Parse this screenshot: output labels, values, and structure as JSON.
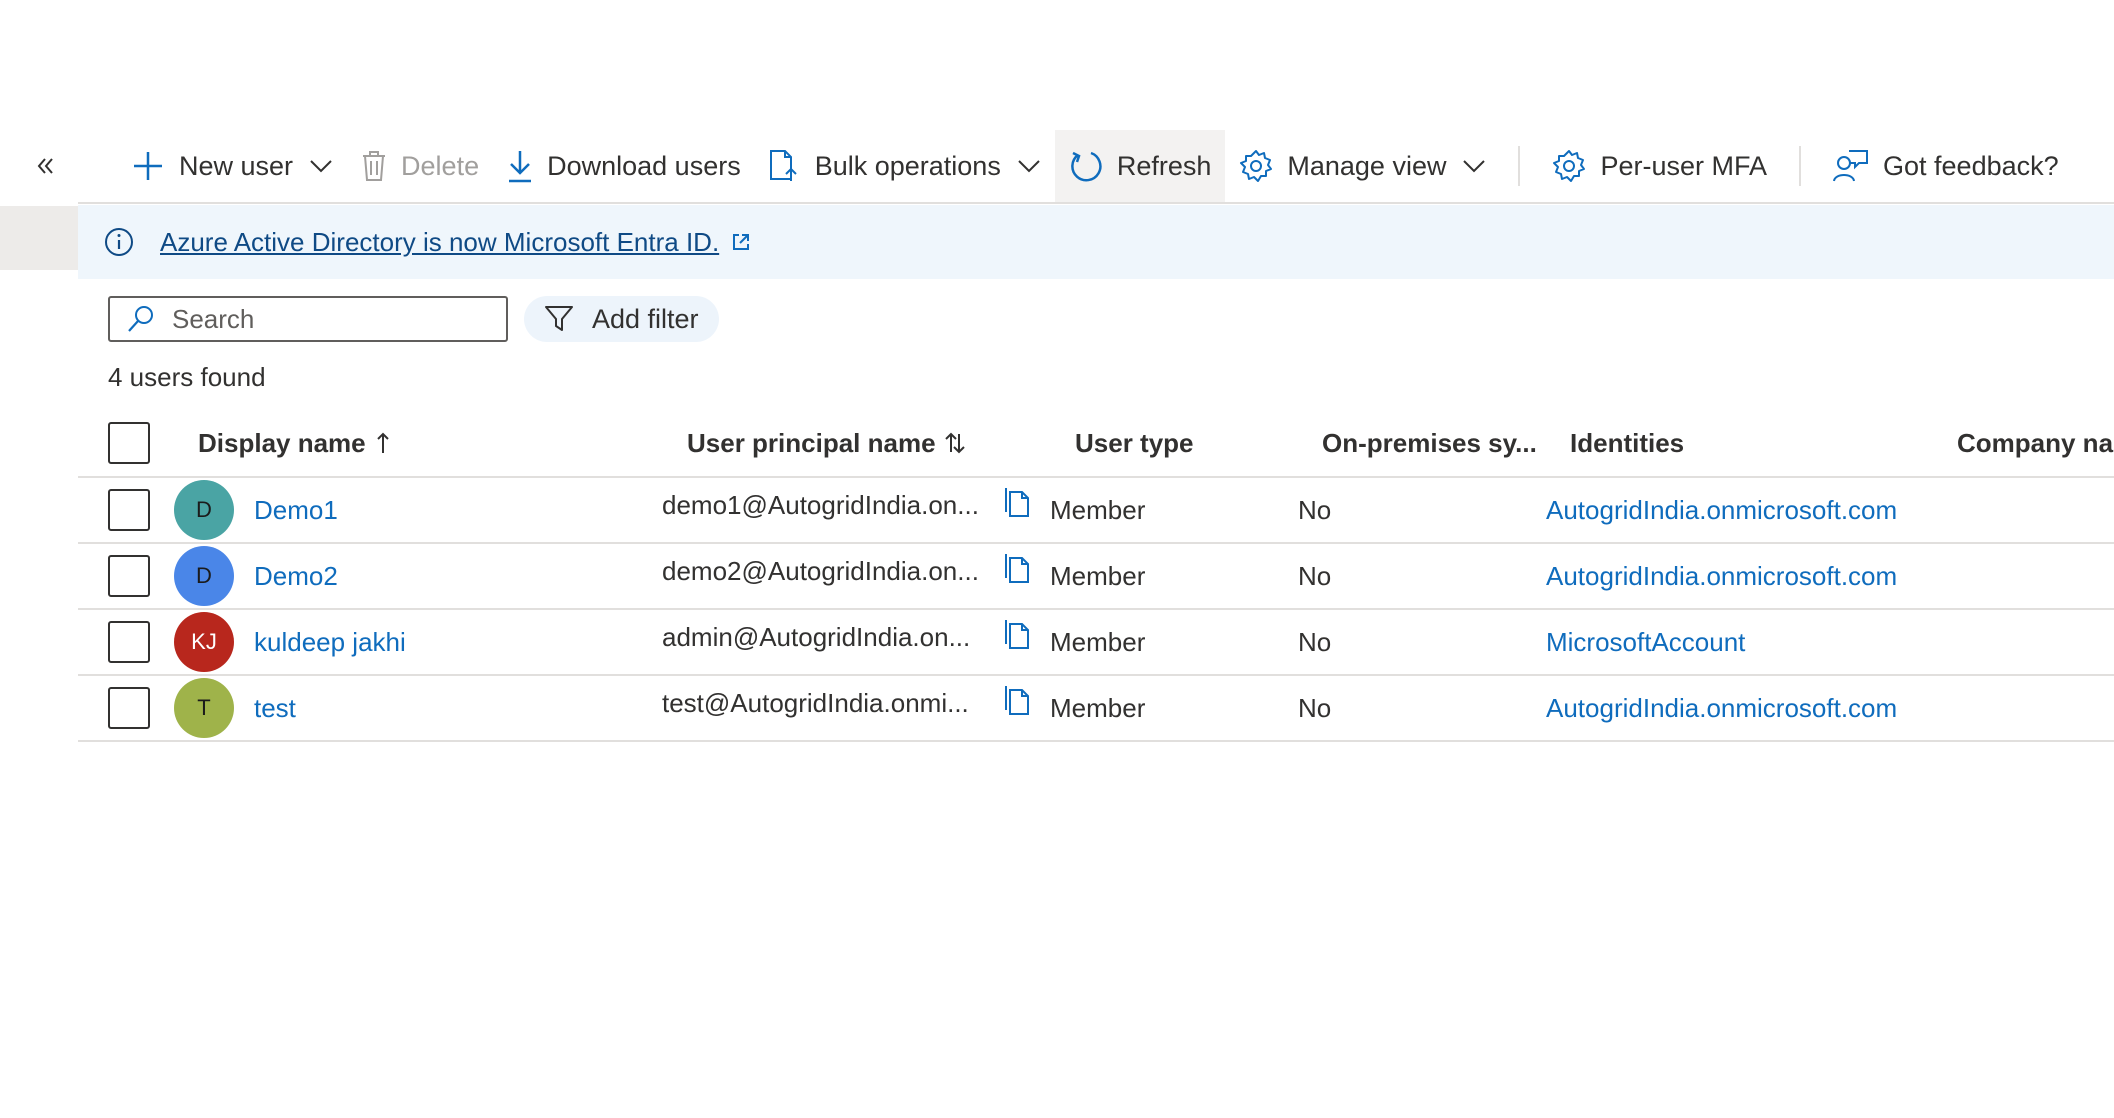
{
  "toolbar": {
    "collapse_icon": "double-chevron-left-icon",
    "new_user": "New user",
    "delete": "Delete",
    "download_users": "Download users",
    "bulk_operations": "Bulk operations",
    "refresh": "Refresh",
    "manage_view": "Manage view",
    "per_user_mfa": "Per-user MFA",
    "got_feedback": "Got feedback?"
  },
  "banner": {
    "icon": "info-icon",
    "text": "Azure Active Directory is now Microsoft Entra ID.",
    "link_icon": "external-link-icon"
  },
  "search": {
    "placeholder": "Search",
    "value": ""
  },
  "filter": {
    "label": "Add filter"
  },
  "results": {
    "count_text": "4 users found"
  },
  "table": {
    "columns": [
      {
        "label": "Display name",
        "sort": "ascending"
      },
      {
        "label": "User principal name",
        "sort": "sortable"
      },
      {
        "label": "User type"
      },
      {
        "label": "On-premises sy..."
      },
      {
        "label": "Identities"
      },
      {
        "label": "Company nar"
      }
    ],
    "rows": [
      {
        "initials": "D",
        "avatar_color": "#4aa4a4",
        "name": "Demo1",
        "upn": "demo1@AutogridIndia.on...",
        "user_type": "Member",
        "on_prem": "No",
        "identities": "AutogridIndia.onmicrosoft.com"
      },
      {
        "initials": "D",
        "avatar_color": "#4a86e8",
        "name": "Demo2",
        "upn": "demo2@AutogridIndia.on...",
        "user_type": "Member",
        "on_prem": "No",
        "identities": "AutogridIndia.onmicrosoft.com"
      },
      {
        "initials": "KJ",
        "avatar_color": "#b8271d",
        "name": "kuldeep jakhi",
        "upn": "admin@AutogridIndia.on...",
        "user_type": "Member",
        "on_prem": "No",
        "identities": "MicrosoftAccount"
      },
      {
        "initials": "T",
        "avatar_color": "#9fb34a",
        "name": "test",
        "upn": "test@AutogridIndia.onmi...",
        "user_type": "Member",
        "on_prem": "No",
        "identities": "AutogridIndia.onmicrosoft.com"
      }
    ]
  },
  "colors": {
    "accent": "#0f6cbd",
    "banner_bg": "#eff6fc",
    "banner_link": "#0f4a85"
  }
}
